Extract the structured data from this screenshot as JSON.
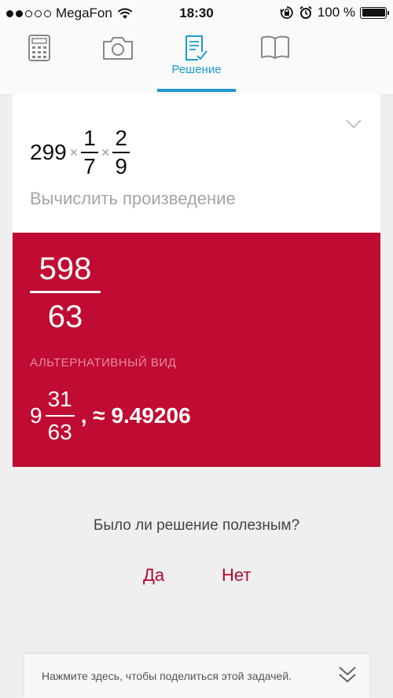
{
  "status_bar": {
    "carrier": "MegaFon",
    "time": "18:30",
    "battery": "100 %",
    "signal_bars_filled": 2,
    "signal_bars_total": 5
  },
  "tabs": [
    {
      "icon": "calculator-icon",
      "label": ""
    },
    {
      "icon": "camera-icon",
      "label": ""
    },
    {
      "icon": "solution-icon",
      "label": "Решение",
      "active": true
    },
    {
      "icon": "book-icon",
      "label": ""
    }
  ],
  "problem": {
    "whole": "299",
    "times": "×",
    "fraction1": {
      "num": "1",
      "den": "7"
    },
    "fraction2": {
      "num": "2",
      "den": "9"
    },
    "task": "Вычислить произведение"
  },
  "answer": {
    "fraction": {
      "num": "598",
      "den": "63"
    },
    "alt_label": "АЛЬТЕРНАТИВНЫЙ ВИД",
    "mixed": {
      "whole": "9",
      "num": "31",
      "den": "63"
    },
    "approx": ", ≈ 9.49206"
  },
  "feedback": {
    "question": "Было ли решение полезным?",
    "yes": "Да",
    "no": "Нет"
  },
  "share": {
    "text": "Нажмите здесь, чтобы поделиться этой задачей."
  },
  "colors": {
    "accent": "#1a9bd0",
    "answer_bg": "#c00c32",
    "feedback_buttons": "#b3092b"
  }
}
